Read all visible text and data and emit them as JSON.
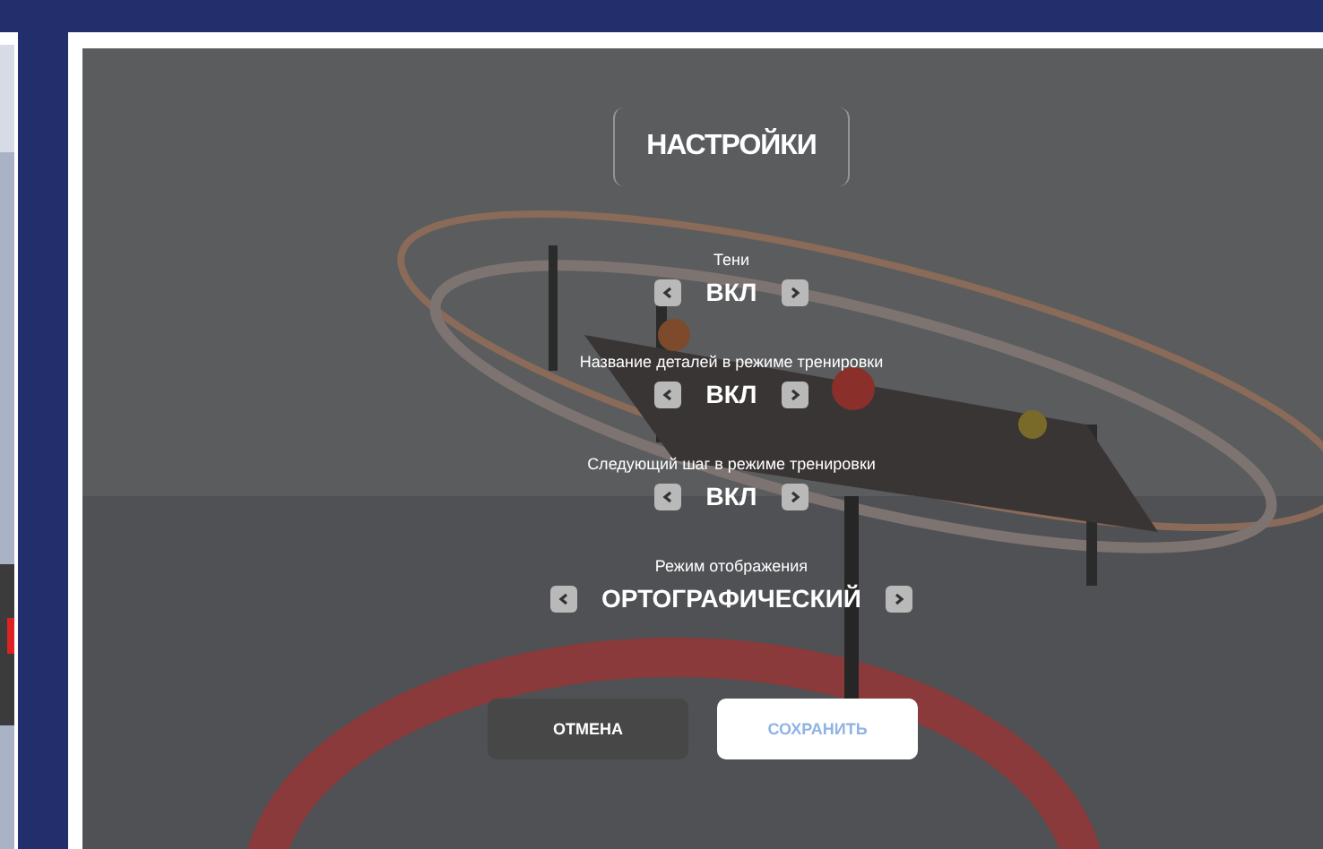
{
  "title": "НАСТРОЙКИ",
  "settings": [
    {
      "label": "Тени",
      "value": "ВКЛ"
    },
    {
      "label": "Название деталей в режиме тренировки",
      "value": "ВКЛ"
    },
    {
      "label": "Следующий шаг в режиме тренировки",
      "value": "ВКЛ"
    },
    {
      "label": "Режим отображения",
      "value": "ОРТОГРАФИЧЕСКИЙ"
    }
  ],
  "buttons": [
    {
      "label": "ОТМЕНА",
      "kind": "secondary"
    },
    {
      "label": "СОХРАНИТЬ",
      "kind": "primary"
    }
  ]
}
